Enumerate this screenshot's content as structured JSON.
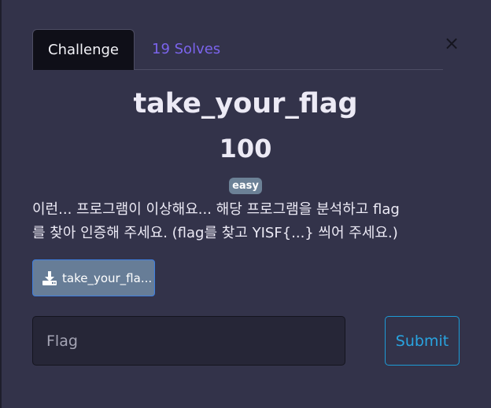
{
  "tabs": {
    "challenge_label": "Challenge",
    "solves_label": "19 Solves"
  },
  "close_icon": "close-icon",
  "challenge": {
    "title": "take_your_flag",
    "points": "100",
    "difficulty": "easy",
    "description_line1": "이런... 프로그램이 이상해요... 해당 프로그램을 분석하고 flag",
    "description_line2": "를 찾아 인증해 주세요. (flag를 찾고 YISF{...} 씌어 주세요.)"
  },
  "file": {
    "label": "take_your_fla...",
    "icon": "download-icon"
  },
  "submission": {
    "placeholder": "Flag",
    "value": "",
    "submit_label": "Submit"
  },
  "colors": {
    "background": "#33334a",
    "accent": "#7b64ec",
    "submit": "#29a4e0",
    "badge": "#6c8196"
  }
}
